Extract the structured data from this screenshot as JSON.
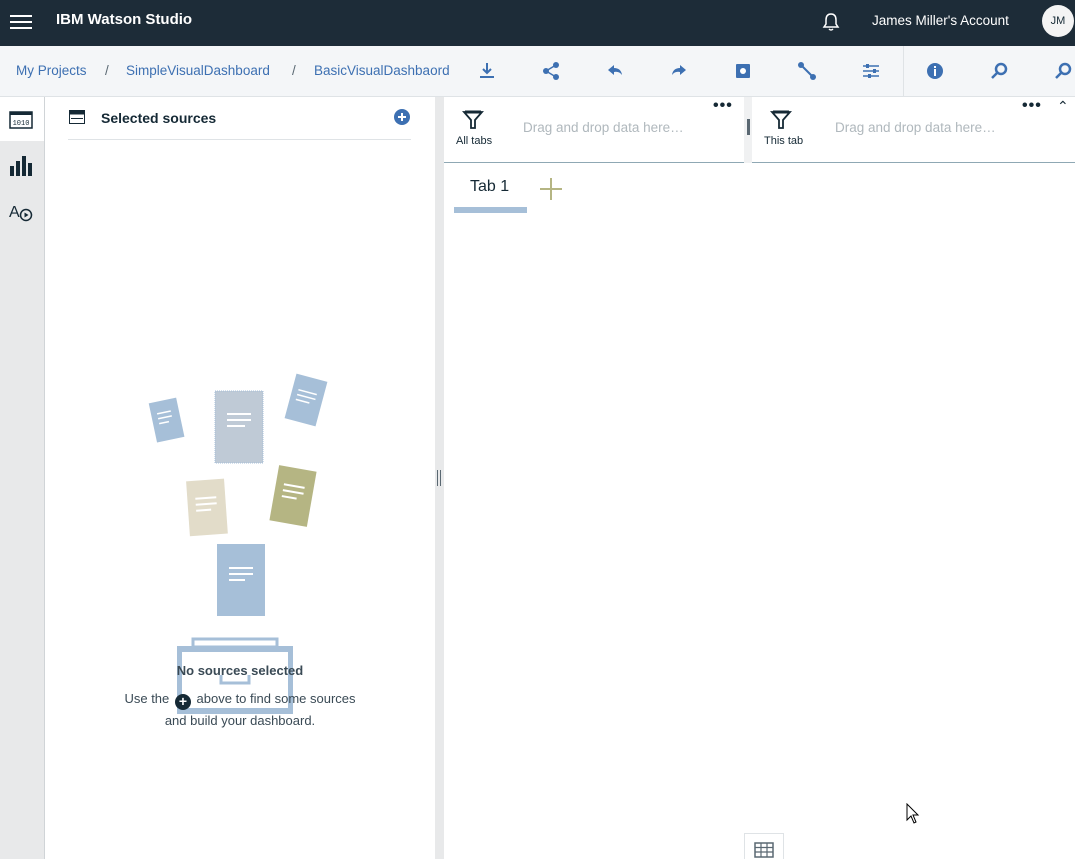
{
  "header": {
    "brand": "IBM Watson Studio",
    "account": "James Miller's Account",
    "avatar_initials": "JM",
    "bg_color": "#1d2c38"
  },
  "breadcrumb": {
    "items": [
      "My Projects",
      "SimpleVisualDashboard",
      "BasicVisualDashbaord"
    ],
    "separator": "/"
  },
  "toolbar_icons": [
    "download-icon",
    "share-icon",
    "undo-icon",
    "redo-icon",
    "snapshot-icon",
    "connections-icon",
    "settings-icon",
    "info-icon",
    "search-icon",
    "find-icon"
  ],
  "rail": [
    "data-sources-icon",
    "visualizations-icon",
    "text-media-icon"
  ],
  "sources_panel": {
    "title": "Selected sources",
    "empty_title": "No sources selected",
    "empty_line1_pre": "Use the",
    "empty_line1_post": "above to find some sources",
    "empty_line2": "and build your dashboard."
  },
  "filters": {
    "all_tabs_label": "All tabs",
    "this_tab_label": "This tab",
    "drop_hint": "Drag and drop data here…",
    "more": "•••"
  },
  "tabs": [
    {
      "label": "Tab 1",
      "selected": true
    }
  ],
  "colors": {
    "accent_blue": "#a6bfd8",
    "accent_olive": "#b5b583",
    "link": "#3d70b2"
  }
}
